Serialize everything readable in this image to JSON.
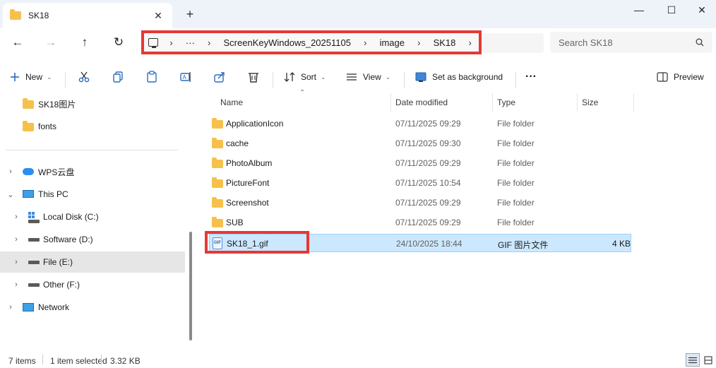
{
  "window": {
    "tab_title": "SK18",
    "tab_close": "✕",
    "new_tab": "+",
    "minimize": "—",
    "maximize": "☐",
    "close": "✕"
  },
  "nav": {
    "back": "←",
    "forward": "→",
    "up": "↑",
    "refresh": "↻"
  },
  "address": {
    "sep": "›",
    "ellipsis": "···",
    "crumbs": [
      "ScreenKeyWindows_20251105",
      "image",
      "SK18"
    ]
  },
  "search": {
    "placeholder": "Search SK18",
    "icon": "search-icon"
  },
  "commands": {
    "new_label": "New",
    "sort_label": "Sort",
    "view_label": "View",
    "set_bg_label": "Set as background",
    "more_label": "···",
    "preview_label": "Preview"
  },
  "sidebar": {
    "items": [
      {
        "label": "SK18图片",
        "icon": "folder-icon"
      },
      {
        "label": "fonts",
        "icon": "folder-icon"
      },
      {
        "label": "WPS云盘",
        "icon": "cloud-icon"
      },
      {
        "label": "This PC",
        "icon": "computer-icon"
      },
      {
        "label": "Local Disk (C:)",
        "icon": "windows-drive-icon"
      },
      {
        "label": "Software (D:)",
        "icon": "drive-icon"
      },
      {
        "label": "File (E:)",
        "icon": "drive-icon",
        "selected": true
      },
      {
        "label": "Other (F:)",
        "icon": "drive-icon"
      },
      {
        "label": "Network",
        "icon": "network-icon"
      }
    ]
  },
  "columns": {
    "name": "Name",
    "date": "Date modified",
    "type": "Type",
    "size": "Size"
  },
  "files": [
    {
      "name": "ApplicationIcon",
      "date": "07/11/2025 09:29",
      "type": "File folder",
      "size": ""
    },
    {
      "name": "cache",
      "date": "07/11/2025 09:30",
      "type": "File folder",
      "size": ""
    },
    {
      "name": "PhotoAlbum",
      "date": "07/11/2025 09:29",
      "type": "File folder",
      "size": ""
    },
    {
      "name": "PictureFont",
      "date": "07/11/2025 10:54",
      "type": "File folder",
      "size": ""
    },
    {
      "name": "Screenshot",
      "date": "07/11/2025 09:29",
      "type": "File folder",
      "size": ""
    },
    {
      "name": "SUB",
      "date": "07/11/2025 09:29",
      "type": "File folder",
      "size": ""
    },
    {
      "name": "SK18_1.gif",
      "date": "24/10/2025 18:44",
      "type": "GIF 图片文件",
      "size": "4 KB",
      "selected": true,
      "icon_text": "GIF"
    }
  ],
  "status": {
    "items": "7 items",
    "selected": "1 item selected",
    "selected_size": "3.32 KB"
  },
  "colors": {
    "accent": "#2a6bc4",
    "highlight_border": "#e53935",
    "selection": "#cce8ff",
    "folder": "#f6c14b"
  }
}
